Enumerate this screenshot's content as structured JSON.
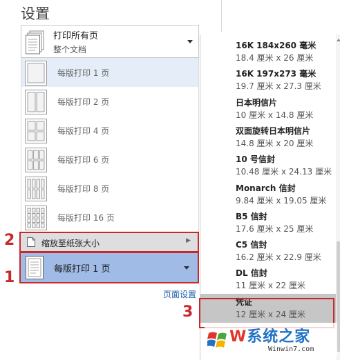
{
  "title": "设置",
  "print_scope": {
    "main": "打印所有页",
    "sub": "整个文档"
  },
  "pages_per_sheet": {
    "options": [
      {
        "label": "每版打印 1 页",
        "cols": 1,
        "rows": 1
      },
      {
        "label": "每版打印 2 页",
        "cols": 2,
        "rows": 1
      },
      {
        "label": "每版打印 4 页",
        "cols": 2,
        "rows": 2
      },
      {
        "label": "每版打印 6 页",
        "cols": 3,
        "rows": 2
      },
      {
        "label": "每版打印 8 页",
        "cols": 4,
        "rows": 2
      },
      {
        "label": "每版打印 16 页",
        "cols": 4,
        "rows": 4
      }
    ],
    "selected": "每版打印 1 页"
  },
  "scale_to_paper": "缩放至纸张大小",
  "page_setup_link": "页面设置",
  "paper_sizes": [
    {
      "name": "16K 184x260 毫米",
      "size": "18.4 厘米 x 26 厘米"
    },
    {
      "name": "16K 197x273 毫米",
      "size": "19.7 厘米 x 27.3 厘米"
    },
    {
      "name": "日本明信片",
      "size": "10 厘米 x 14.8 厘米"
    },
    {
      "name": "双面旋转日本明信片",
      "size": "14.8 厘米 x 20 厘米"
    },
    {
      "name": "10 号信封",
      "size": "10.48 厘米 x 24.13 厘米"
    },
    {
      "name": "Monarch 信封",
      "size": "9.84 厘米 x 19.05 厘米"
    },
    {
      "name": "B5 信封",
      "size": "17.6 厘米 x 25 厘米"
    },
    {
      "name": "C5 信封",
      "size": "16.2 厘米 x 22.9 厘米"
    },
    {
      "name": "DL 信封",
      "size": "11 厘米 x 22 厘米"
    },
    {
      "name": "凭证",
      "size": "12 厘米 x 24 厘米"
    }
  ],
  "selected_paper_index": 9,
  "markers": [
    "1",
    "2",
    "3"
  ],
  "watermark": {
    "brand_prefix": "W",
    "brand": "系统之家",
    "url": "Winwin7.com"
  },
  "colors": {
    "highlight_red": "#c8282b",
    "selected_blue": "#9fbbe6",
    "link_blue": "#1f5ea9"
  }
}
